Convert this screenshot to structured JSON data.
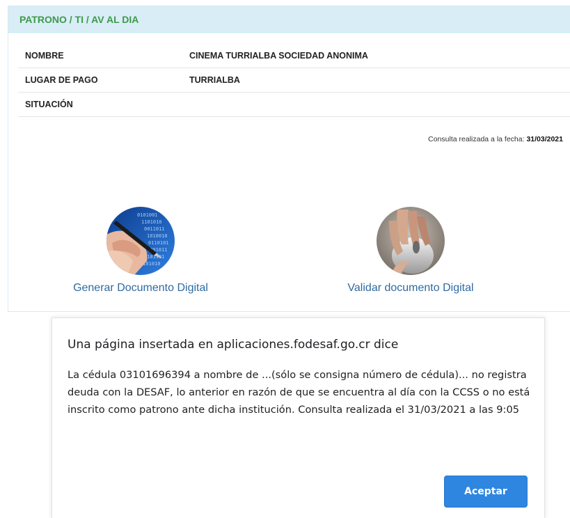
{
  "panel": {
    "heading": "PATRONO / TI / AV AL DIA",
    "rows": [
      {
        "label": "NOMBRE",
        "value": "CINEMA TURRIALBA SOCIEDAD ANONIMA"
      },
      {
        "label": "LUGAR DE PAGO",
        "value": "TURRIALBA"
      },
      {
        "label": "SITUACIÓN",
        "value": ""
      }
    ],
    "consult_prefix": "Consulta realizada a la fecha: ",
    "consult_date": "31/03/2021"
  },
  "tiles": {
    "generate": {
      "label": "Generar Documento Digital",
      "icon": "hand-pen-digital-icon"
    },
    "validate": {
      "label": "Validar documento Digital",
      "icon": "hand-mouse-icon"
    }
  },
  "dialog": {
    "title": "Una página insertada en aplicaciones.fodesaf.go.cr dice",
    "message": "La cédula 03101696394 a nombre de ...(sólo se consigna número de cédula)... no registra deuda con la DESAF, lo anterior en razón de que se encuentra al día con la CCSS o no está inscrito como patrono ante dicha institución. Consulta realizada el 31/03/2021 a las 9:05",
    "ok_label": "Aceptar",
    "ok_color": "#2f86e0"
  },
  "colors": {
    "heading_bg": "#d9edf7",
    "heading_text": "#3c9a4a",
    "link": "#2f6aa0"
  }
}
